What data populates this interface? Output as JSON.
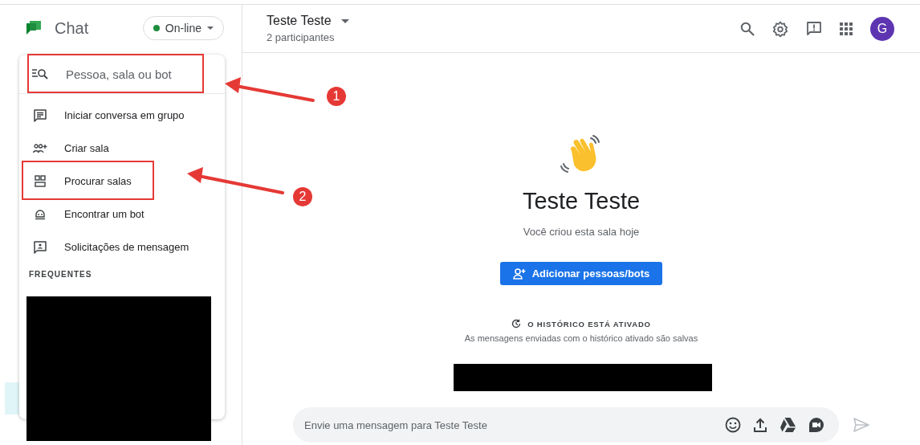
{
  "sidebar": {
    "app_name": "Chat",
    "status": {
      "label": "On-line"
    }
  },
  "menu": {
    "search": {
      "placeholder": "Pessoa, sala ou bot"
    },
    "items": [
      {
        "kind": "group",
        "label": "Iniciar conversa em grupo"
      },
      {
        "kind": "room",
        "label": "Criar sala"
      },
      {
        "kind": "browse",
        "label": "Procurar salas"
      },
      {
        "kind": "bot",
        "label": "Encontrar um bot"
      },
      {
        "kind": "requests",
        "label": "Solicitações de mensagem"
      }
    ],
    "section_title": "FREQUENTES"
  },
  "header": {
    "title": "Teste Teste",
    "subtitle": "2 participantes",
    "avatar": "G"
  },
  "welcome": {
    "title": "Teste Teste",
    "subtitle": "Você criou esta sala hoje",
    "button": "Adicionar pessoas/bots",
    "history_title": "O HISTÓRICO ESTÁ ATIVADO",
    "history_note": "As mensagens enviadas com o histórico ativado são salvas"
  },
  "composer": {
    "placeholder": "Envie uma mensagem para Teste Teste"
  },
  "annotations": [
    {
      "label": "1"
    },
    {
      "label": "2"
    }
  ]
}
